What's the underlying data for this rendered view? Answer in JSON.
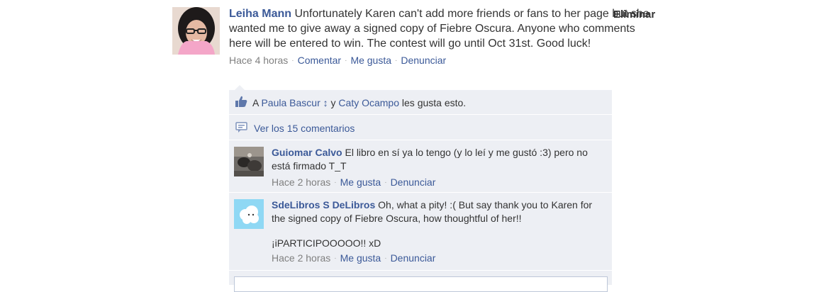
{
  "post": {
    "author": "Leiha Mann",
    "text": "Unfortunately Karen can't add more friends or fans to her page but she wanted me to give away a signed copy of Fiebre Oscura. Anyone who comments here will be entered to win. The contest will go until Oct 31st. Good luck!",
    "delete_label": "Eliminar",
    "time": "Hace 4 horas",
    "actions": [
      "Comentar",
      "Me gusta",
      "Denunciar"
    ]
  },
  "likes": {
    "prefix": "A",
    "user1": "Paula Bascur",
    "mark": "↕",
    "conj": "y",
    "user2": "Caty Ocampo",
    "suffix": "les gusta esto."
  },
  "view_comments": "Ver los 15 comentarios",
  "comments": [
    {
      "author": "Guiomar Calvo",
      "text": "El libro en sí ya lo tengo (y lo leí y me gustó :3) pero no está firmado T_T",
      "time": "Hace 2 horas",
      "actions": [
        "Me gusta",
        "Denunciar"
      ]
    },
    {
      "author": "SdeLibros S DeLibros",
      "text": "Oh, what a pity! :( But say thank you to Karen for the signed copy of Fiebre Oscura, how thoughtful of her!!",
      "text2": "¡iPARTICIPOOOOO!! xD",
      "time": "Hace 2 horas",
      "actions": [
        "Me gusta",
        "Denunciar"
      ]
    }
  ],
  "icons": {
    "like": "thumbs-up-icon",
    "comments": "speech-bubble-icon"
  },
  "colors": {
    "link": "#3b5998",
    "ufi_bg": "#edeff4",
    "meta": "#808080"
  }
}
